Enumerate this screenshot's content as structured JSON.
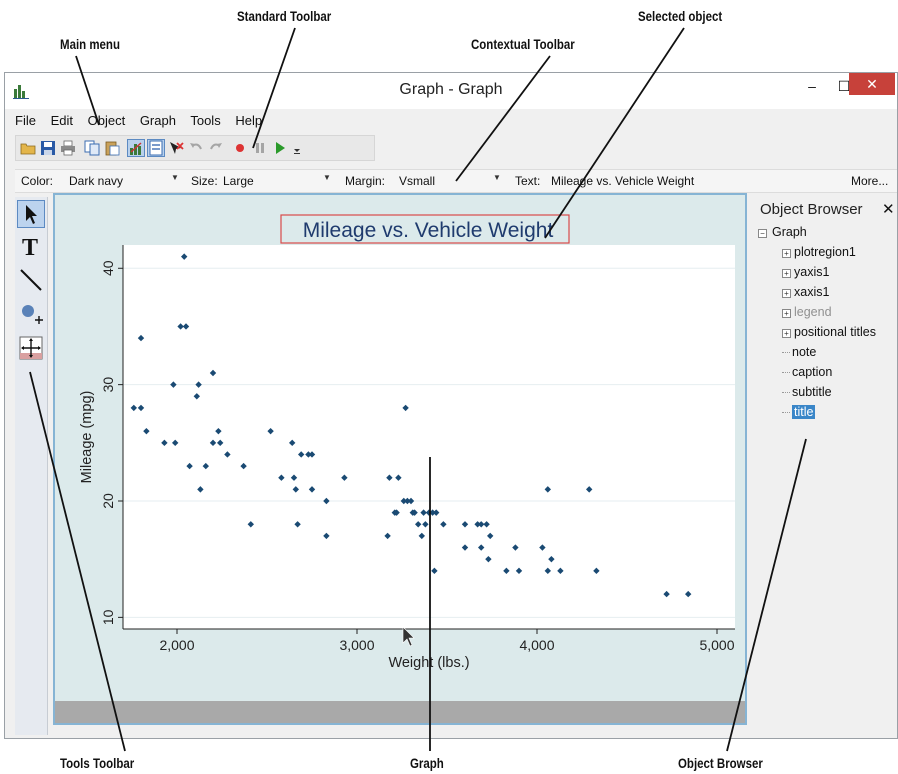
{
  "callouts": {
    "standard_toolbar": "Standard Toolbar",
    "main_menu": "Main menu",
    "contextual_toolbar": "Contextual Toolbar",
    "selected_object": "Selected object",
    "tools_toolbar": "Tools Toolbar",
    "graph": "Graph",
    "object_browser": "Object Browser"
  },
  "window": {
    "title": "Graph - Graph",
    "minimize": "–",
    "maximize": "☐",
    "close": "✕"
  },
  "menu": [
    "File",
    "Edit",
    "Object",
    "Graph",
    "Tools",
    "Help"
  ],
  "contextual": {
    "color_label": "Color:",
    "color_value": "Dark navy",
    "size_label": "Size:",
    "size_value": "Large",
    "margin_label": "Margin:",
    "margin_value": "Vsmall",
    "text_label": "Text:",
    "text_value": "Mileage vs. Vehicle Weight",
    "more": "More..."
  },
  "object_browser": {
    "title": "Object Browser",
    "close": "✕",
    "root": "Graph",
    "items": [
      {
        "label": "plotregion1",
        "expandable": true,
        "dim": false,
        "selected": false
      },
      {
        "label": "yaxis1",
        "expandable": true,
        "dim": false,
        "selected": false
      },
      {
        "label": "xaxis1",
        "expandable": true,
        "dim": false,
        "selected": false
      },
      {
        "label": "legend",
        "expandable": true,
        "dim": true,
        "selected": false
      },
      {
        "label": "positional titles",
        "expandable": true,
        "dim": false,
        "selected": false
      },
      {
        "label": "note",
        "expandable": false,
        "dim": false,
        "selected": false
      },
      {
        "label": "caption",
        "expandable": false,
        "dim": false,
        "selected": false
      },
      {
        "label": "subtitle",
        "expandable": false,
        "dim": false,
        "selected": false
      },
      {
        "label": "title",
        "expandable": false,
        "dim": false,
        "selected": true
      }
    ]
  },
  "colors": {
    "marker": "#1a4a73",
    "title_text": "#1f3b6e",
    "selection_box": "#d94a4a",
    "plot_bg": "#ffffff",
    "graph_bg": "#dceaeb"
  },
  "chart_data": {
    "type": "scatter",
    "title": "Mileage vs. Vehicle Weight",
    "xlabel": "Weight (lbs.)",
    "ylabel": "Mileage (mpg)",
    "xlim": [
      1700,
      5100
    ],
    "ylim": [
      9,
      42
    ],
    "xticks": [
      2000,
      3000,
      4000,
      5000
    ],
    "xtick_labels": [
      "2,000",
      "3,000",
      "4,000",
      "5,000"
    ],
    "yticks": [
      10,
      20,
      30,
      40
    ],
    "ytick_labels": [
      "10",
      "20",
      "30",
      "40"
    ],
    "grid": "horizontal",
    "points": [
      [
        1760,
        28
      ],
      [
        1800,
        28
      ],
      [
        1800,
        34
      ],
      [
        1830,
        26
      ],
      [
        1930,
        25
      ],
      [
        1980,
        30
      ],
      [
        1990,
        25
      ],
      [
        2020,
        35
      ],
      [
        2040,
        41
      ],
      [
        2050,
        35
      ],
      [
        2070,
        23
      ],
      [
        2110,
        29
      ],
      [
        2120,
        30
      ],
      [
        2130,
        21
      ],
      [
        2160,
        23
      ],
      [
        2200,
        31
      ],
      [
        2200,
        25
      ],
      [
        2230,
        26
      ],
      [
        2240,
        25
      ],
      [
        2280,
        24
      ],
      [
        2370,
        23
      ],
      [
        2410,
        18
      ],
      [
        2520,
        26
      ],
      [
        2580,
        22
      ],
      [
        2640,
        25
      ],
      [
        2650,
        22
      ],
      [
        2660,
        21
      ],
      [
        2670,
        18
      ],
      [
        2690,
        24
      ],
      [
        2730,
        24
      ],
      [
        2750,
        24
      ],
      [
        2750,
        21
      ],
      [
        2830,
        20
      ],
      [
        2830,
        17
      ],
      [
        2930,
        22
      ],
      [
        3170,
        17
      ],
      [
        3180,
        22
      ],
      [
        3210,
        19
      ],
      [
        3220,
        19
      ],
      [
        3230,
        22
      ],
      [
        3260,
        20
      ],
      [
        3270,
        28
      ],
      [
        3280,
        20
      ],
      [
        3300,
        20
      ],
      [
        3310,
        19
      ],
      [
        3320,
        19
      ],
      [
        3340,
        18
      ],
      [
        3360,
        17
      ],
      [
        3370,
        19
      ],
      [
        3380,
        18
      ],
      [
        3400,
        19
      ],
      [
        3420,
        19
      ],
      [
        3430,
        14
      ],
      [
        3440,
        19
      ],
      [
        3480,
        18
      ],
      [
        3600,
        18
      ],
      [
        3600,
        16
      ],
      [
        3670,
        18
      ],
      [
        3690,
        16
      ],
      [
        3690,
        18
      ],
      [
        3720,
        18
      ],
      [
        3730,
        15
      ],
      [
        3740,
        17
      ],
      [
        3830,
        14
      ],
      [
        3880,
        16
      ],
      [
        3900,
        14
      ],
      [
        4030,
        16
      ],
      [
        4060,
        14
      ],
      [
        4060,
        21
      ],
      [
        4080,
        15
      ],
      [
        4130,
        14
      ],
      [
        4290,
        21
      ],
      [
        4330,
        14
      ],
      [
        4720,
        12
      ],
      [
        4840,
        12
      ]
    ]
  }
}
